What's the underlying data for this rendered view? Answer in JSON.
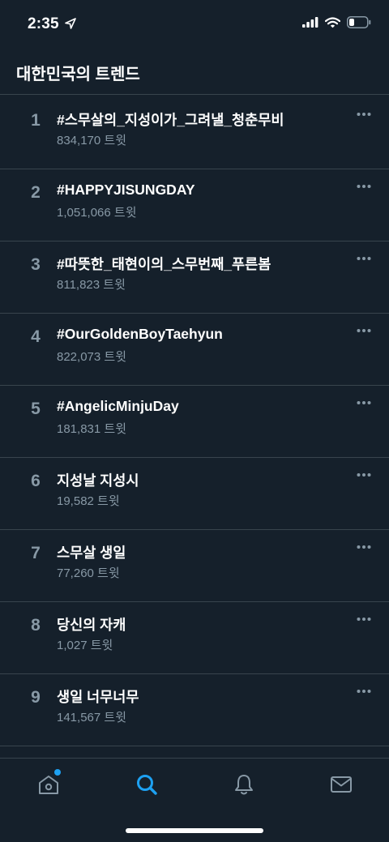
{
  "status_bar": {
    "time": "2:35",
    "icons": [
      "location-arrow-icon",
      "cellular-signal-icon",
      "wifi-icon",
      "battery-icon"
    ]
  },
  "header": {
    "title": "대한민국의 트렌드"
  },
  "trends": [
    {
      "rank": "1",
      "name": "#스무살의_지성이가_그려낼_청춘무비",
      "count": "834,170 트윗"
    },
    {
      "rank": "2",
      "name": "#HAPPYJISUNGDAY",
      "count": "1,051,066 트윗"
    },
    {
      "rank": "3",
      "name": "#따뜻한_태현이의_스무번째_푸른봄",
      "count": "811,823 트윗"
    },
    {
      "rank": "4",
      "name": "#OurGoldenBoyTaehyun",
      "count": "822,073 트윗"
    },
    {
      "rank": "5",
      "name": "#AngelicMinjuDay",
      "count": "181,831 트윗"
    },
    {
      "rank": "6",
      "name": "지성날 지성시",
      "count": "19,582 트윗"
    },
    {
      "rank": "7",
      "name": "스무살 생일",
      "count": "77,260 트윗"
    },
    {
      "rank": "8",
      "name": "당신의 자캐",
      "count": "1,027 트윗"
    },
    {
      "rank": "9",
      "name": "생일 너무너무",
      "count": "141,567 트윗"
    }
  ],
  "tab_bar": {
    "tabs": [
      "home-icon",
      "search-icon",
      "notifications-icon",
      "messages-icon"
    ],
    "active": "search-icon",
    "home_has_notification_dot": true
  },
  "colors": {
    "background": "#15202b",
    "divider": "#38444d",
    "secondary_text": "#8899a6",
    "accent": "#1da1f2"
  }
}
